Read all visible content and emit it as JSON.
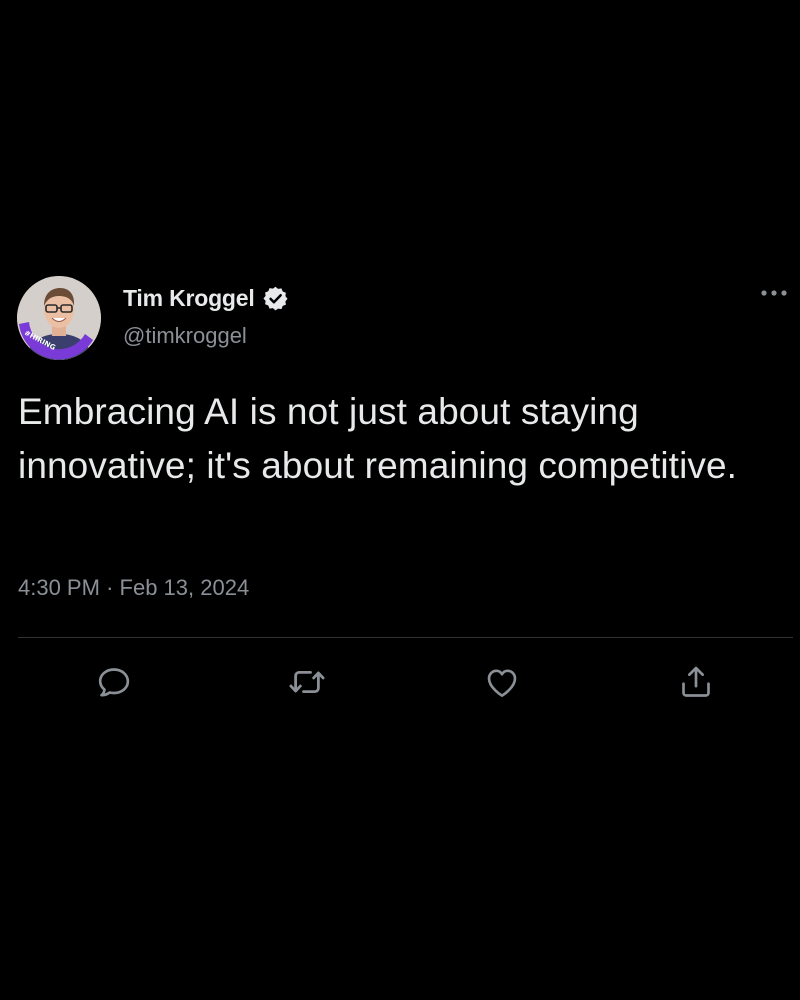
{
  "author": {
    "name": "Tim Kroggel",
    "handle": "@timkroggel",
    "verified": true,
    "avatar_badge_text": "#HIRING",
    "avatar_badge_color": "#7a3ad8"
  },
  "tweet": {
    "text": "Embracing AI is not just about staying innovative; it's about remaining competitive.",
    "time": "4:30 PM",
    "separator": "·",
    "date": "Feb 13, 2024"
  },
  "actions": [
    {
      "name": "reply",
      "icon": "speech-bubble-icon"
    },
    {
      "name": "retweet",
      "icon": "retweet-icon"
    },
    {
      "name": "like",
      "icon": "heart-icon"
    },
    {
      "name": "share",
      "icon": "share-upload-icon"
    }
  ],
  "menu": {
    "icon": "more-options-icon"
  },
  "colors": {
    "background": "#000000",
    "primary_text": "#e7e9ea",
    "secondary_text": "#8b9096",
    "divider": "#2f3336",
    "icon": "#8b9096"
  }
}
